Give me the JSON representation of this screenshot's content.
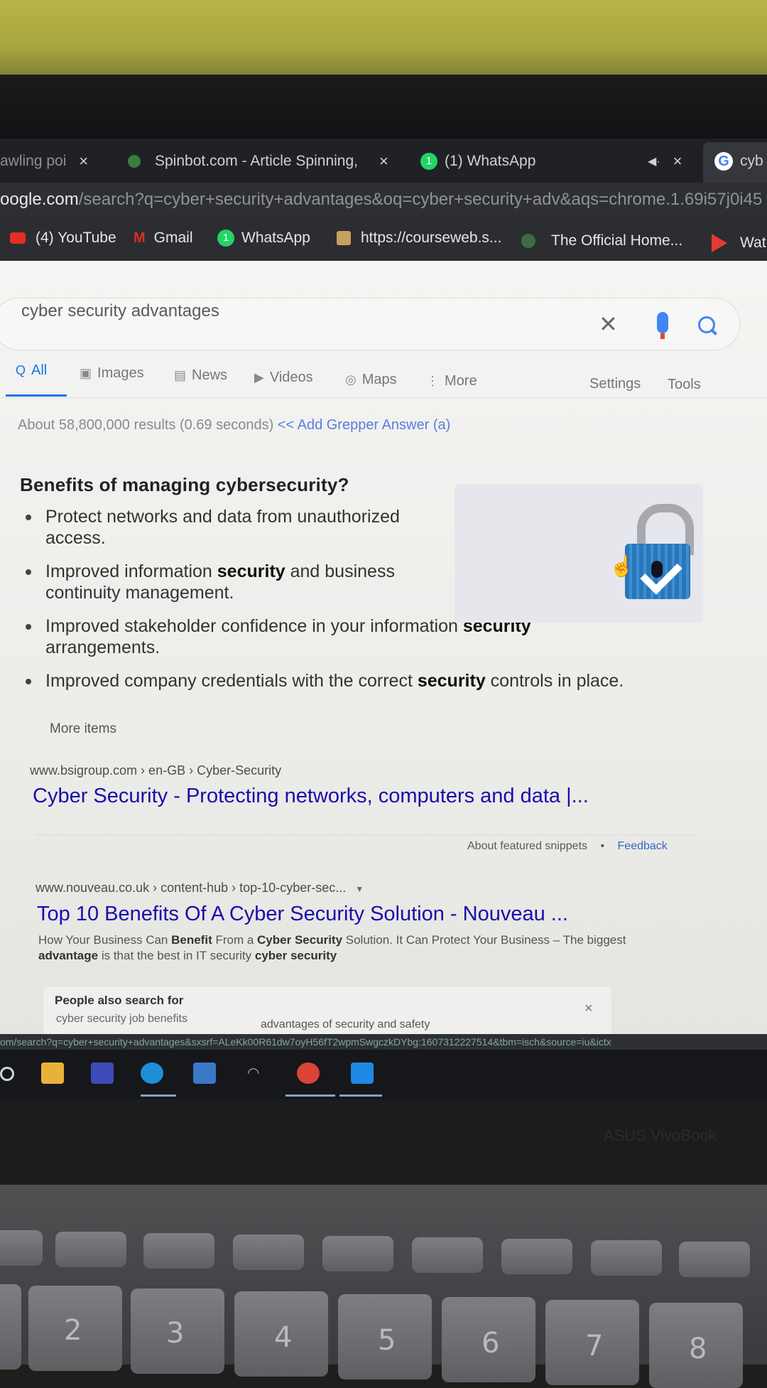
{
  "tabs": [
    {
      "label": "awling poi",
      "close": "×"
    },
    {
      "label": "Spinbot.com - Article Spinning,",
      "close": "×"
    },
    {
      "label": "(1) WhatsApp",
      "badge": "1",
      "close": "×"
    },
    {
      "label": "cyb"
    }
  ],
  "address": {
    "host": "oogle.com",
    "path": "/search?q=cyber+security+advantages&oq=cyber+security+adv&aqs=chrome.1.69i57j0i45"
  },
  "bookmarks": [
    {
      "label": "(4) YouTube"
    },
    {
      "label": "Gmail",
      "icon": "M"
    },
    {
      "label": "WhatsApp",
      "badge": "1"
    },
    {
      "label": "https://courseweb.s..."
    },
    {
      "label": "The Official Home..."
    },
    {
      "label": "Wat"
    }
  ],
  "search": {
    "query": "cyber security advantages",
    "tabs": [
      "All",
      "Images",
      "News",
      "Videos",
      "Maps",
      "More"
    ],
    "tab_icons": [
      "Q",
      "▣",
      "▤",
      "▶",
      "◎",
      "⋮"
    ],
    "settings": "Settings",
    "tools": "Tools",
    "stats": "About 58,800,000 results (0.69 seconds)",
    "grepper": "<< Add Grepper Answer (a)"
  },
  "snippet": {
    "title": "Benefits of managing cybersecurity?",
    "bullets": [
      {
        "pre": "Protect networks and data from unauthorized access.",
        "bold": "",
        "post": ""
      },
      {
        "pre": "Improved information ",
        "bold": "security",
        "post": " and business continuity management."
      },
      {
        "pre": "Improved stakeholder confidence in your information ",
        "bold": "security",
        "post": " arrangements."
      },
      {
        "pre": "Improved company credentials with the correct ",
        "bold": "security",
        "post": " controls in place."
      }
    ],
    "more": "More items",
    "cite": "www.bsigroup.com › en-GB › Cyber-Security",
    "link": "Cyber Security - Protecting networks, computers and data |...",
    "about": "About featured snippets",
    "dot": "•",
    "feedback": "Feedback"
  },
  "result2": {
    "cite": "www.nouveau.co.uk › content-hub › top-10-cyber-sec...",
    "title": "Top 10 Benefits Of A Cyber Security Solution - Nouveau ...",
    "s1": "How Your Business Can ",
    "b1": "Benefit",
    "s2": " From a ",
    "b2": "Cyber Security",
    "s3": " Solution. It Can Protect Your Business – The biggest ",
    "b3": "advantage",
    "s4": " is that the best in IT security ",
    "b4": "cyber security"
  },
  "people_also": {
    "title": "People also search for",
    "a": "cyber security job benefits",
    "b": "advantages of security and safety",
    "close": "×"
  },
  "status_url": "om/search?q=cyber+security+advantages&sxsrf=ALeKk00R61dw7oyH56fT2wpmSwgczkDYbg:1607312227514&tbm=isch&source=iu&ictx",
  "brand": "ASUS VivoBook",
  "keys": [
    "2",
    "3",
    "4",
    "5",
    "6",
    "7",
    "8"
  ],
  "colors": {
    "link": "#1a0dab",
    "accent": "#1a73e8",
    "chrome_dark": "#2d2f33"
  }
}
